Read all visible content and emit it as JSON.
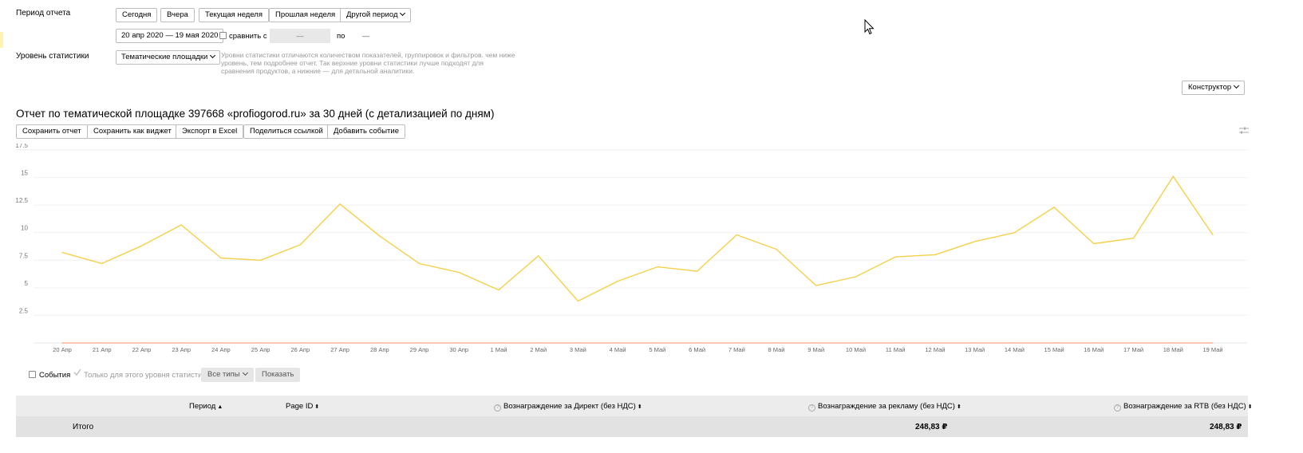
{
  "filters": {
    "period_label": "Период отчета",
    "period_buttons": [
      "Сегодня",
      "Вчера",
      "Текущая неделя",
      "Прошлая неделя"
    ],
    "other_period": "Другой период",
    "date_range": "20 апр 2020 — 19 мая 2020",
    "compare_label": "сравнить с",
    "compare_from": "—",
    "compare_to_label": "по",
    "compare_to": "—",
    "level_label": "Уровень статистики",
    "level_value": "Тематические площадки",
    "level_hint": "Уровни статистики отличаются количеством показателей, группировок и фильтров. чем ниже уровень, тем подробнее отчет. Так верхние уровни статистики лучше подходят для сравнения продуктов, а нижние — для детальной аналитики."
  },
  "constructor_button": "Конструктор",
  "report": {
    "title": "Отчет по тематической площадке 397668 «profiogorod.ru» за 30 дней (с детализацией по дням)",
    "actions": [
      "Сохранить отчет",
      "Сохранить как виджет",
      "Экспорт в Excel",
      "Поделиться ссылкой",
      "Добавить событие"
    ]
  },
  "chart_data": {
    "type": "line",
    "x": [
      "20 Апр",
      "21 Апр",
      "22 Апр",
      "23 Апр",
      "24 Апр",
      "25 Апр",
      "26 Апр",
      "27 Апр",
      "28 Апр",
      "29 Апр",
      "30 Апр",
      "1 Май",
      "2 Май",
      "3 Май",
      "4 Май",
      "5 Май",
      "6 Май",
      "7 Май",
      "8 Май",
      "9 Май",
      "10 Май",
      "11 Май",
      "12 Май",
      "13 Май",
      "14 Май",
      "15 Май",
      "16 Май",
      "17 Май",
      "18 Май",
      "19 Май"
    ],
    "y_ticks": [
      "2.5",
      "5",
      "7.5",
      "10",
      "12.5",
      "15",
      "17.5"
    ],
    "ylim": [
      0,
      17.5
    ],
    "series": [
      {
        "color": "#f5d04a",
        "values": [
          8.2,
          7.2,
          8.8,
          10.7,
          7.7,
          7.5,
          8.9,
          12.6,
          9.7,
          7.2,
          6.4,
          4.8,
          7.9,
          3.8,
          5.6,
          6.9,
          6.5,
          9.8,
          8.5,
          5.2,
          6.0,
          7.8,
          8.0,
          9.2,
          10.0,
          12.3,
          9.0,
          9.5,
          15.1,
          9.8
        ]
      },
      {
        "color": "#f4a582",
        "values": [
          0,
          0,
          0,
          0,
          0,
          0,
          0,
          0,
          0,
          0,
          0,
          0,
          0,
          0,
          0,
          0,
          0,
          0,
          0,
          0,
          0,
          0,
          0,
          0,
          0,
          0,
          0,
          0,
          0,
          0
        ]
      }
    ],
    "grid": true
  },
  "events": {
    "events_label": "События",
    "only_level_label": "Только для этого уровня статистики",
    "all_types": "Все типы",
    "show": "Показать"
  },
  "table": {
    "headers": {
      "period": "Период",
      "page_id": "Page ID",
      "direct": "Вознаграждение за Директ (без НДС)",
      "ads": "Вознаграждение за рекламу (без НДС)",
      "rtb": "Вознаграждение за RTB (без НДС)"
    },
    "total_label": "Итого",
    "total_ads": "248,83 ₽",
    "total_rtb": "248,83 ₽"
  }
}
